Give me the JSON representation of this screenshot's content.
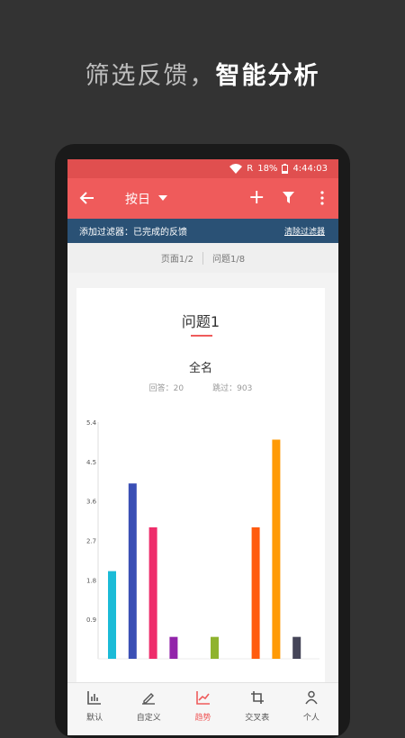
{
  "headline": {
    "part1": "筛选反馈，",
    "part2": "智能分析"
  },
  "status": {
    "battery": "18%",
    "time": "4:44:03",
    "network": "R"
  },
  "toolbar": {
    "title": "按日"
  },
  "filter": {
    "text": "添加过滤器：已完成的反馈",
    "clear": "清除过滤器"
  },
  "pager": {
    "page": "页面1/2",
    "question": "问题1/8"
  },
  "card": {
    "title": "问题1",
    "subtitle": "全名",
    "answered": "回答：20",
    "skipped": "跳过：903"
  },
  "chart_data": {
    "type": "bar",
    "yticks": [
      "0.9",
      "1.8",
      "2.7",
      "3.6",
      "4.5",
      "5.4"
    ],
    "ylim": [
      0,
      5.4
    ],
    "values": [
      2.0,
      4.0,
      3.0,
      0.5,
      0,
      0.5,
      0,
      3.0,
      5.0,
      0.5
    ],
    "colors": [
      "#1bbbd7",
      "#3a4fb5",
      "#ee2d6b",
      "#9224aa",
      null,
      "#8fb32e",
      null,
      "#ff5b0f",
      "#ff9a05",
      "#454558"
    ]
  },
  "nav": [
    {
      "label": "默认",
      "icon": "bar-chart-icon"
    },
    {
      "label": "自定义",
      "icon": "edit-icon"
    },
    {
      "label": "趋势",
      "icon": "trend-icon"
    },
    {
      "label": "交叉表",
      "icon": "crosstab-icon"
    },
    {
      "label": "个人",
      "icon": "person-icon"
    }
  ]
}
